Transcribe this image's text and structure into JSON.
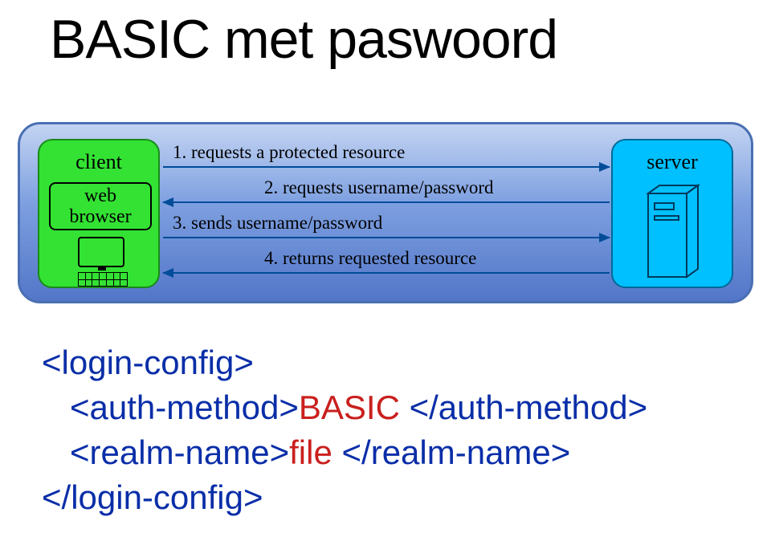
{
  "title": "BASIC met paswoord",
  "diagram": {
    "client_label": "client",
    "browser_label": "web\nbrowser",
    "server_label": "server",
    "steps": [
      "1. requests a protected resource",
      "2. requests username/password",
      "3. sends username/password",
      "4. returns requested resource"
    ]
  },
  "code": {
    "line1": {
      "open": "<login-config>"
    },
    "line2": {
      "open": "<auth-method>",
      "text": "BASIC",
      "space": " ",
      "close": "</auth-method>"
    },
    "line3": {
      "open": "<realm-name>",
      "text": "file",
      "space": " ",
      "close": "</realm-name>"
    },
    "line4": {
      "close": "</login-config>"
    }
  }
}
